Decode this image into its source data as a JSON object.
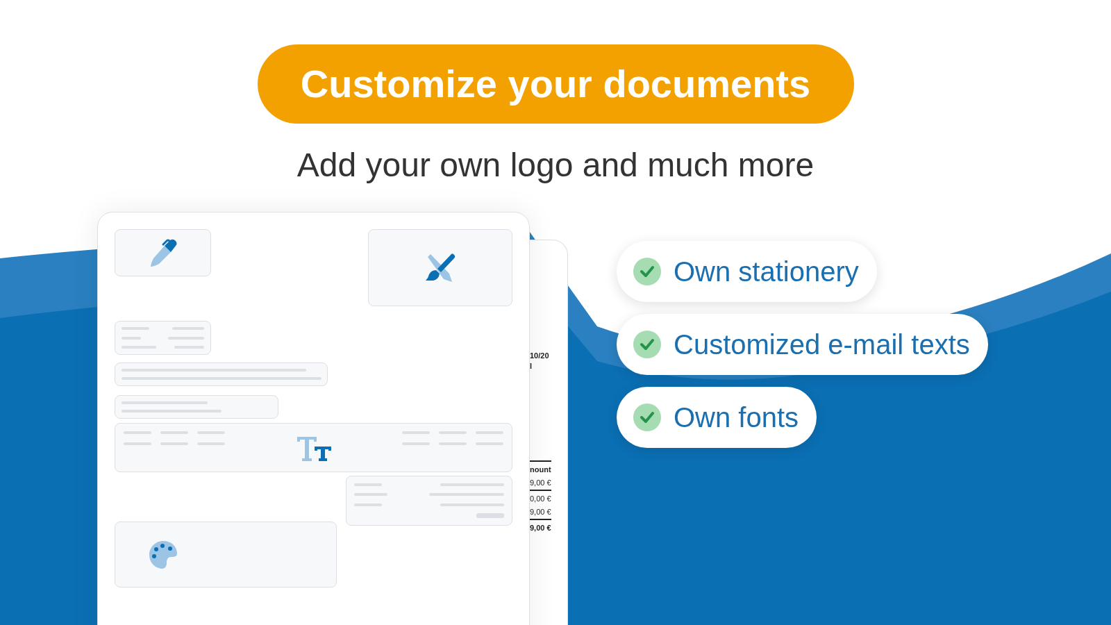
{
  "headline": "Customize your documents",
  "subheadline": "Add your own logo and much more",
  "back_document": {
    "header_lines": [
      {
        "text": "10/20",
        "kind": "bold"
      },
      {
        "text": "l",
        "kind": "bold"
      }
    ],
    "table_lines": [
      {
        "text": "nount",
        "kind": "bold",
        "rule_above": true
      },
      {
        "text": "9,00 €",
        "kind": "normal",
        "rule_above": false
      },
      {
        "text": "0,00 €",
        "kind": "normal",
        "rule_above": true
      },
      {
        "text": "9,00 €",
        "kind": "normal",
        "rule_above": false
      },
      {
        "text": "9,00 €",
        "kind": "bold",
        "rule_above": true
      }
    ]
  },
  "features": [
    {
      "label": "Own stationery",
      "checked": true
    },
    {
      "label": "Customized e-mail texts",
      "checked": true
    },
    {
      "label": "Own fonts",
      "checked": true
    }
  ]
}
